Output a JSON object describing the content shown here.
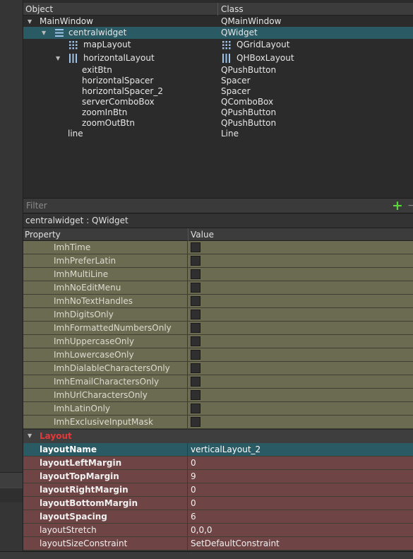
{
  "object_inspector": {
    "col_object": "Object",
    "col_class": "Class",
    "rows": [
      {
        "name": "MainWindow",
        "cls": "QMainWindow"
      },
      {
        "name": "centralwidget",
        "cls": "QWidget"
      },
      {
        "name": "mapLayout",
        "cls": "QGridLayout"
      },
      {
        "name": "horizontalLayout",
        "cls": "QHBoxLayout"
      },
      {
        "name": "exitBtn",
        "cls": "QPushButton"
      },
      {
        "name": "horizontalSpacer",
        "cls": "Spacer"
      },
      {
        "name": "horizontalSpacer_2",
        "cls": "Spacer"
      },
      {
        "name": "serverComboBox",
        "cls": "QComboBox"
      },
      {
        "name": "zoomInBtn",
        "cls": "QPushButton"
      },
      {
        "name": "zoomOutBtn",
        "cls": "QPushButton"
      },
      {
        "name": "line",
        "cls": "Line"
      }
    ]
  },
  "filter": {
    "placeholder": "Filter"
  },
  "object_title": "centralwidget : QWidget",
  "property_editor": {
    "col_property": "Property",
    "col_value": "Value",
    "flags": [
      "ImhTime",
      "ImhPreferLatin",
      "ImhMultiLine",
      "ImhNoEditMenu",
      "ImhNoTextHandles",
      "ImhDigitsOnly",
      "ImhFormattedNumbersOnly",
      "ImhUppercaseOnly",
      "ImhLowercaseOnly",
      "ImhDialableCharactersOnly",
      "ImhEmailCharactersOnly",
      "ImhUrlCharactersOnly",
      "ImhLatinOnly",
      "ImhExclusiveInputMask"
    ],
    "group_label": "Layout",
    "layout_props": [
      {
        "name": "layoutName",
        "value": "verticalLayout_2"
      },
      {
        "name": "layoutLeftMargin",
        "value": "0"
      },
      {
        "name": "layoutTopMargin",
        "value": "9"
      },
      {
        "name": "layoutRightMargin",
        "value": "0"
      },
      {
        "name": "layoutBottomMargin",
        "value": "0"
      },
      {
        "name": "layoutSpacing",
        "value": "6"
      },
      {
        "name": "layoutStretch",
        "value": "0,0,0"
      },
      {
        "name": "layoutSizeConstraint",
        "value": "SetDefaultConstraint"
      }
    ]
  },
  "colors": {
    "selection": "#2a5a64",
    "olive": "#6a6b51",
    "maroon": "#6e4444",
    "group_label": "#e23a3a",
    "add_icon": "#58d63a"
  }
}
